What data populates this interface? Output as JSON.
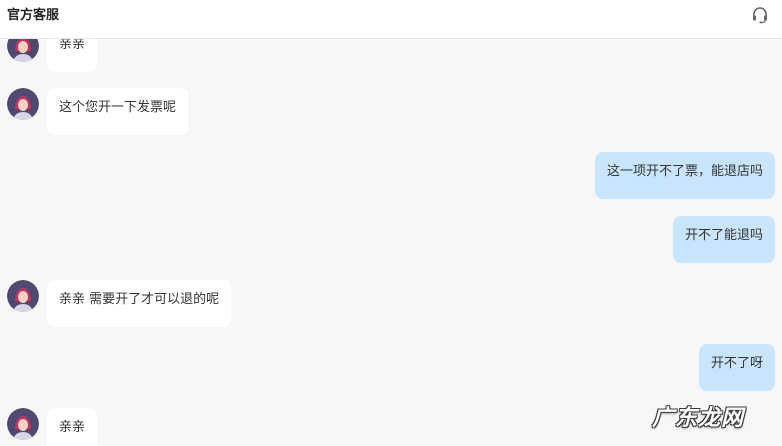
{
  "header": {
    "title": "官方客服",
    "support_icon": "headset-icon"
  },
  "messages": [
    {
      "side": "left",
      "text": "亲亲"
    },
    {
      "side": "left",
      "text": "这个您开一下发票呢"
    },
    {
      "side": "right",
      "text": "这一项开不了票，能退店吗"
    },
    {
      "side": "right",
      "text": "开不了能退吗"
    },
    {
      "side": "left",
      "text": "亲亲 需要开了才可以退的呢"
    },
    {
      "side": "right",
      "text": "开不了呀"
    },
    {
      "side": "left",
      "text": "亲亲"
    }
  ],
  "watermark": "广东龙网",
  "colors": {
    "outgoing_bubble": "#c9e5fb",
    "incoming_bubble": "#ffffff",
    "background": "#f7f7f7"
  }
}
